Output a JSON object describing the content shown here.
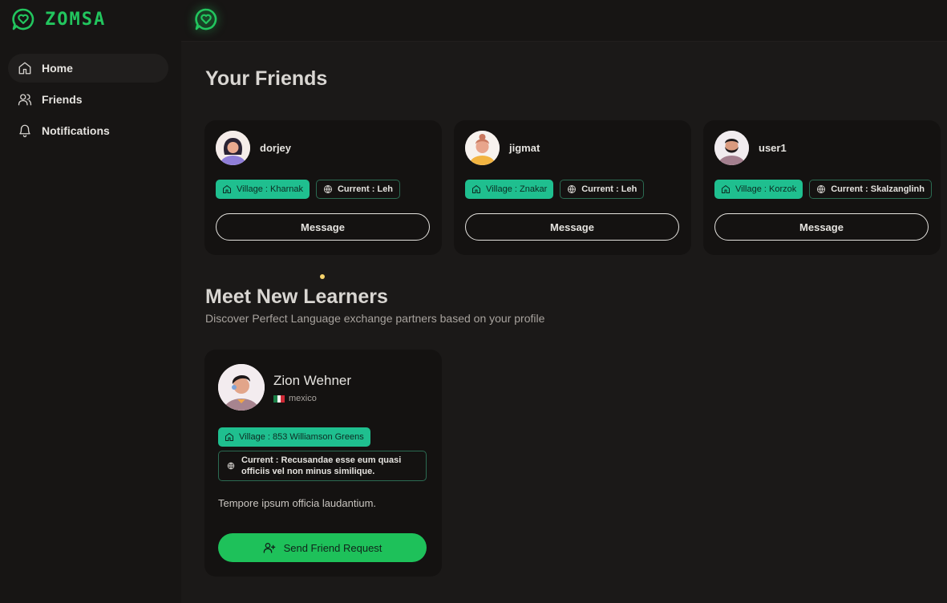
{
  "app": {
    "name": "ZOMSA",
    "accent": "#22c55e"
  },
  "sidebar": {
    "items": [
      {
        "label": "Home",
        "icon": "home-icon",
        "active": true
      },
      {
        "label": "Friends",
        "icon": "users-icon"
      },
      {
        "label": "Notifications",
        "icon": "bell-icon"
      }
    ]
  },
  "friends_section": {
    "title": "Your Friends",
    "friends": [
      {
        "name": "dorjey",
        "village": "Village : Kharnak",
        "current": "Current : Leh",
        "button": "Message"
      },
      {
        "name": "jigmat",
        "village": "Village : Znakar",
        "current": "Current : Leh",
        "button": "Message"
      },
      {
        "name": "user1",
        "village": "Village : Korzok",
        "current": "Current : Skalzanglinh",
        "button": "Message"
      }
    ]
  },
  "learners_section": {
    "title": "Meet New Learners",
    "subtitle": "Discover Perfect Language exchange partners based on your profile",
    "learner": {
      "name": "Zion Wehner",
      "country": "mexico",
      "village": "Village : 853 Williamson Greens",
      "current": "Current : Recusandae esse eum quasi officiis vel non minus similique.",
      "bio": "Tempore ipsum officia laudantium.",
      "button": "Send Friend Request"
    }
  }
}
